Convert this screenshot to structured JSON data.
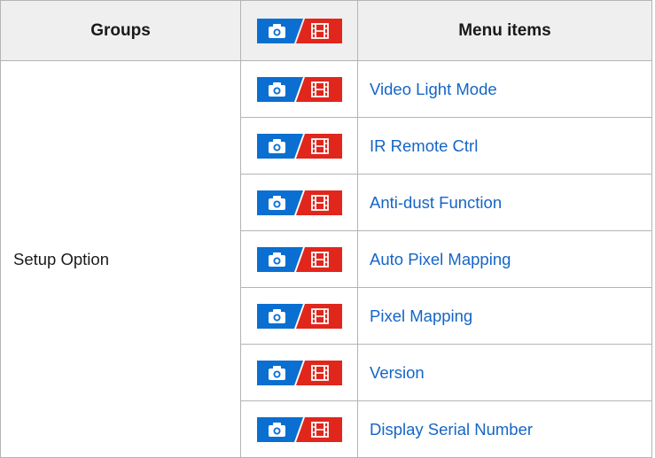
{
  "table": {
    "headers": {
      "groups": "Groups",
      "icons_icon": "still-movie-icon",
      "menu_items": "Menu items"
    },
    "group_label": "Setup Option",
    "rows": [
      {
        "icon": "still-movie-icon",
        "label": "Video Light Mode"
      },
      {
        "icon": "still-movie-icon",
        "label": "IR Remote Ctrl"
      },
      {
        "icon": "still-movie-icon",
        "label": "Anti-dust Function"
      },
      {
        "icon": "still-movie-icon",
        "label": "Auto Pixel Mapping"
      },
      {
        "icon": "still-movie-icon",
        "label": "Pixel Mapping"
      },
      {
        "icon": "still-movie-icon",
        "label": "Version"
      },
      {
        "icon": "still-movie-icon",
        "label": "Display Serial Number"
      }
    ]
  },
  "colors": {
    "still_blue": "#0a6fd1",
    "movie_red": "#e1261c",
    "link_blue": "#1565c6",
    "header_bg": "#efefef",
    "border": "#b4b4b4"
  }
}
